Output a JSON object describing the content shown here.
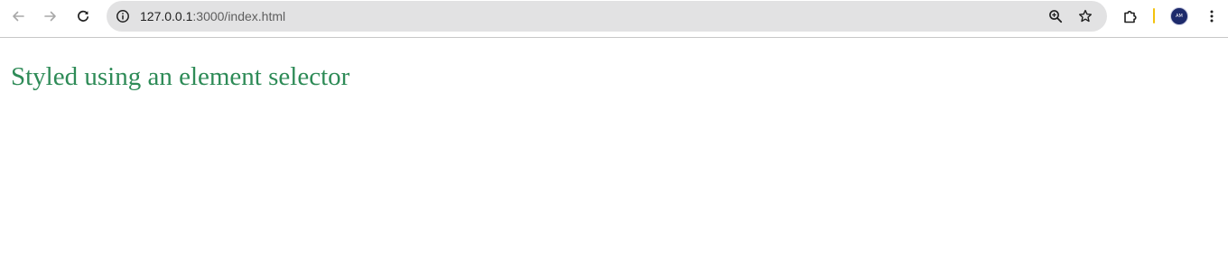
{
  "browser": {
    "url_host": "127.0.0.1",
    "url_path": ":3000/index.html",
    "profile_initials": "AM"
  },
  "icons": {
    "back": "arrow-left-icon",
    "forward": "arrow-right-icon",
    "reload": "reload-icon",
    "site_info": "info-icon",
    "zoom": "zoom-in-icon",
    "bookmark": "star-icon",
    "extensions": "puzzle-icon",
    "menu": "three-dots-icon"
  },
  "colors": {
    "heading": "#2e8b57",
    "omnibox_bg": "#e2e2e3",
    "separator": "#f4c20d",
    "avatar_bg": "#1d2a6b"
  },
  "page": {
    "heading": "Styled using an element selector"
  }
}
